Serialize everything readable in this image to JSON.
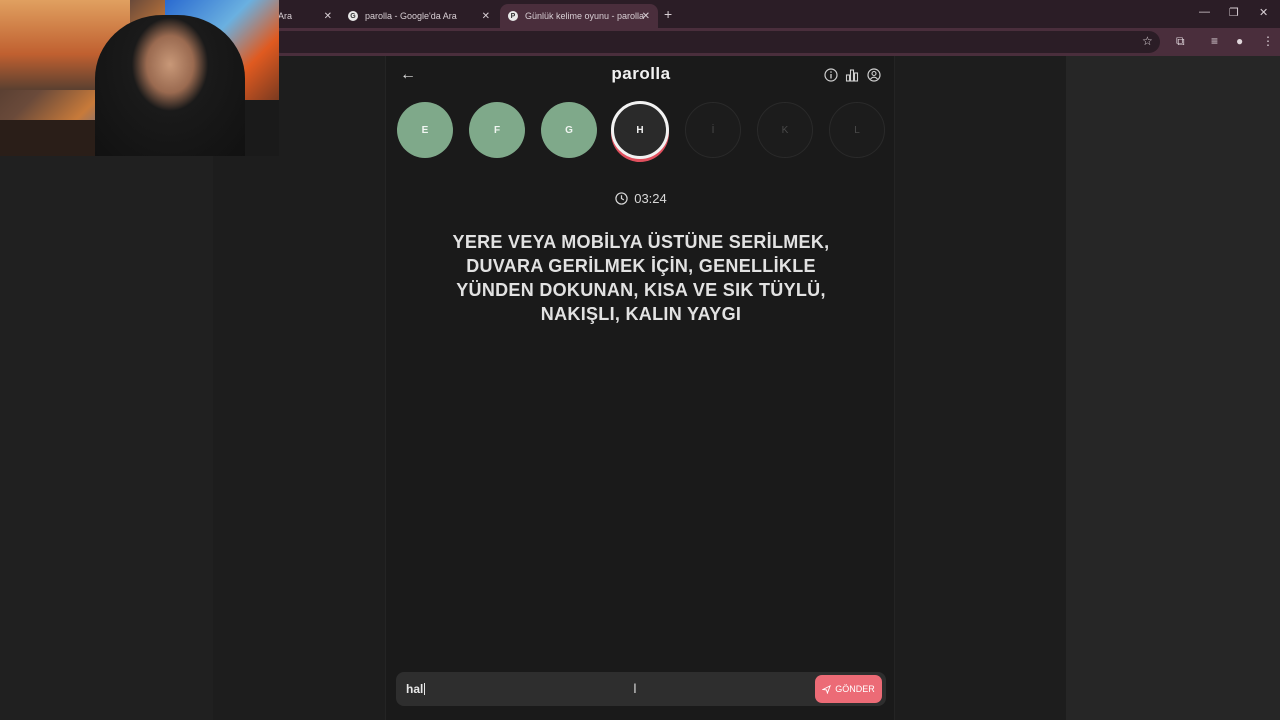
{
  "browser": {
    "tabs": [
      {
        "label": "Ara"
      },
      {
        "label": "parolla - Google'da Ara"
      },
      {
        "label": "Günlük kelime oyunu - parolla"
      }
    ]
  },
  "app": {
    "title": "parolla",
    "letters": [
      {
        "letter": "E",
        "state": "done"
      },
      {
        "letter": "F",
        "state": "done"
      },
      {
        "letter": "G",
        "state": "done"
      },
      {
        "letter": "H",
        "state": "current"
      },
      {
        "letter": "İ",
        "state": "future"
      },
      {
        "letter": "K",
        "state": "future"
      },
      {
        "letter": "L",
        "state": "future"
      }
    ],
    "timer": "03:24",
    "question": "YERE VEYA MOBİLYA ÜSTÜNE SERİLMEK, DUVARA GERİLMEK İÇİN, GENELLİKLE YÜNDEN DOKUNAN, KISA VE SIK TÜYLÜ, NAKIŞLI, KALIN YAYGI",
    "answer_value": "hal",
    "send_label": "GÖNDER"
  },
  "colors": {
    "done": "#7fa98a",
    "accent": "#ec6b76",
    "background": "#1a1a1a"
  }
}
